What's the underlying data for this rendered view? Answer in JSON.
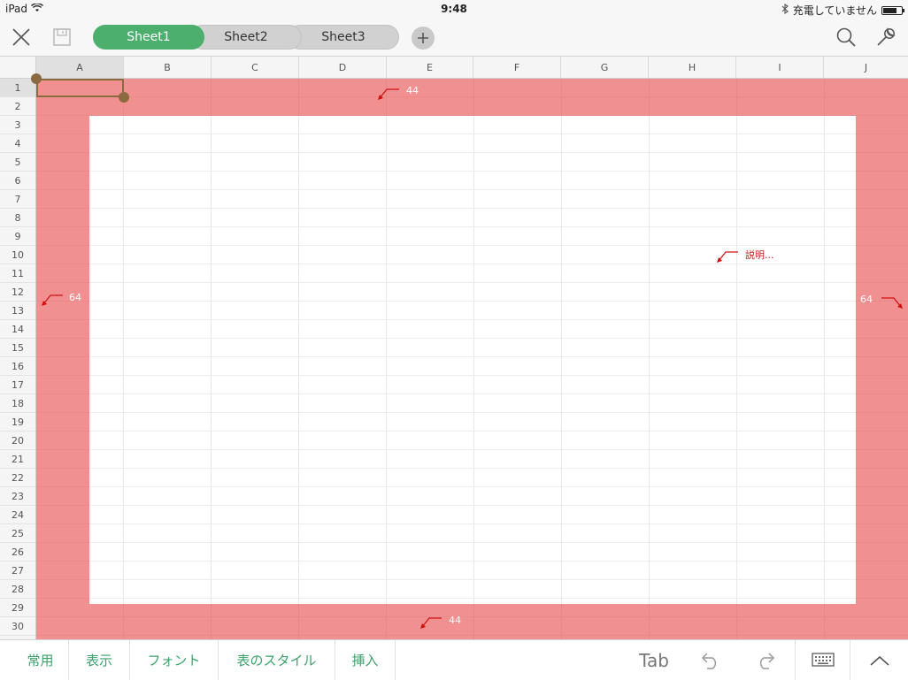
{
  "status_bar": {
    "device": "iPad",
    "time": "9:48",
    "charging_text": "充電していません",
    "icons": [
      "wifi-icon",
      "bluetooth-icon",
      "battery-icon"
    ]
  },
  "toolbar": {
    "close_icon": "close-icon",
    "save_icon": "save-icon",
    "sheets": [
      {
        "label": "Sheet1",
        "active": true
      },
      {
        "label": "Sheet2",
        "active": false
      },
      {
        "label": "Sheet3",
        "active": false
      }
    ],
    "add_sheet_icon": "plus-icon",
    "search_icon": "search-icon",
    "tools_icon": "wrench-icon"
  },
  "grid": {
    "columns": [
      "A",
      "B",
      "C",
      "D",
      "E",
      "F",
      "G",
      "H",
      "I",
      "J"
    ],
    "rows": [
      "1",
      "2",
      "3",
      "4",
      "5",
      "6",
      "7",
      "8",
      "9",
      "10",
      "11",
      "12",
      "13",
      "14",
      "15",
      "16",
      "17",
      "18",
      "19",
      "20",
      "21",
      "22",
      "23",
      "24",
      "25",
      "26",
      "27",
      "28",
      "29",
      "30"
    ],
    "selected_cell": "A1"
  },
  "annotations": {
    "top": "44",
    "bottom": "44",
    "left": "64",
    "right": "64",
    "description": "説明..."
  },
  "bottom_bar": {
    "tabs": [
      "常用",
      "表示",
      "フォント",
      "表のスタイル",
      "挿入"
    ],
    "tab_label": "Tab",
    "icons": [
      "undo-icon",
      "redo-icon",
      "keyboard-icon",
      "chevron-up-icon"
    ]
  },
  "colors": {
    "accent": "#4caf6e",
    "overlay": "#e84c4c",
    "selection": "#8a6a3e"
  }
}
